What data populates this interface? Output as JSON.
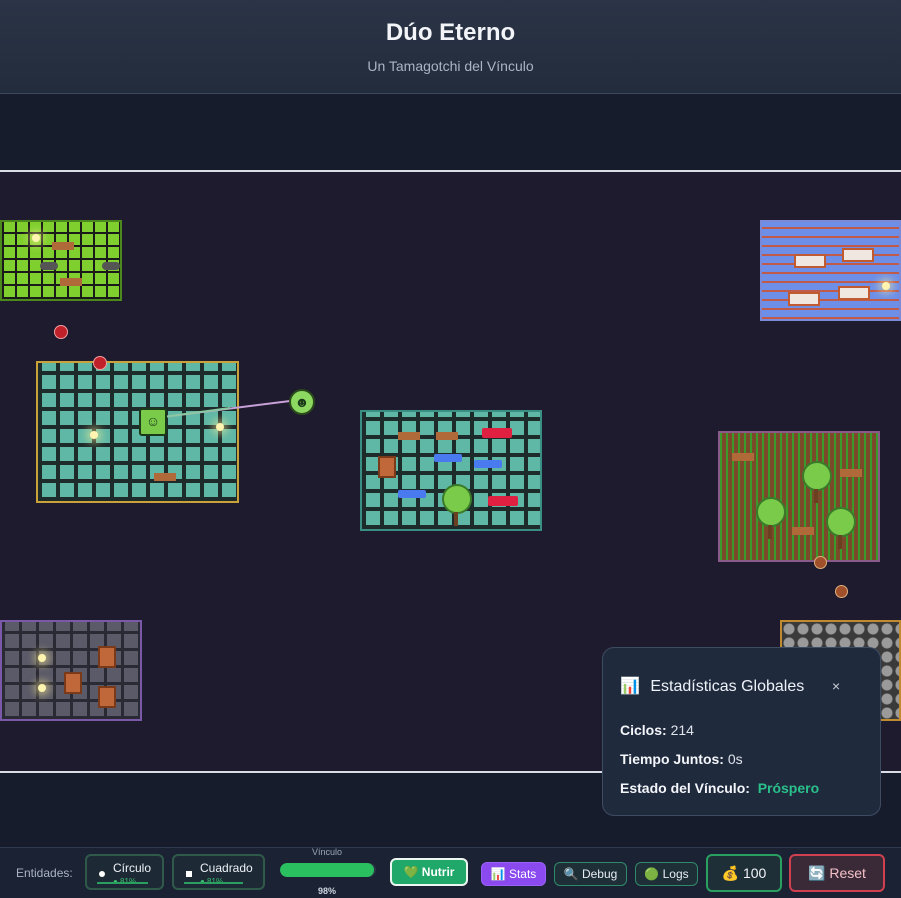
{
  "header": {
    "title": "Dúo Eterno",
    "subtitle": "Un Tamagotchi del Vínculo"
  },
  "entities": {
    "square_face": "☺",
    "circle_face": "☻"
  },
  "stats_panel": {
    "icon": "📊",
    "title": "Estadísticas Globales",
    "close": "×",
    "cycles_label": "Ciclos:",
    "cycles_value": "214",
    "time_label": "Tiempo Juntos:",
    "time_value": "0s",
    "bond_label": "Estado del Vínculo:",
    "bond_value": "Próspero"
  },
  "toolbar": {
    "entities_label": "Entidades:",
    "circle": {
      "name": "Círculo",
      "pct": "● 81%"
    },
    "square": {
      "name": "Cuadrado",
      "pct": "● 81%"
    },
    "bond_label": "Vínculo",
    "bond_value": "98%",
    "bond_fraction": 0.98,
    "feed_button": "💚 Nutrir",
    "stats_button": "📊 Stats",
    "debug_button": "🔍 Debug",
    "logs_button": "🟢 Logs",
    "money": "💰 100",
    "reset_button": "🔄 Reset"
  },
  "colors": {
    "accent_green": "#2ac060",
    "stats_purple": "#8a4af0",
    "reset_red": "#d04050"
  }
}
